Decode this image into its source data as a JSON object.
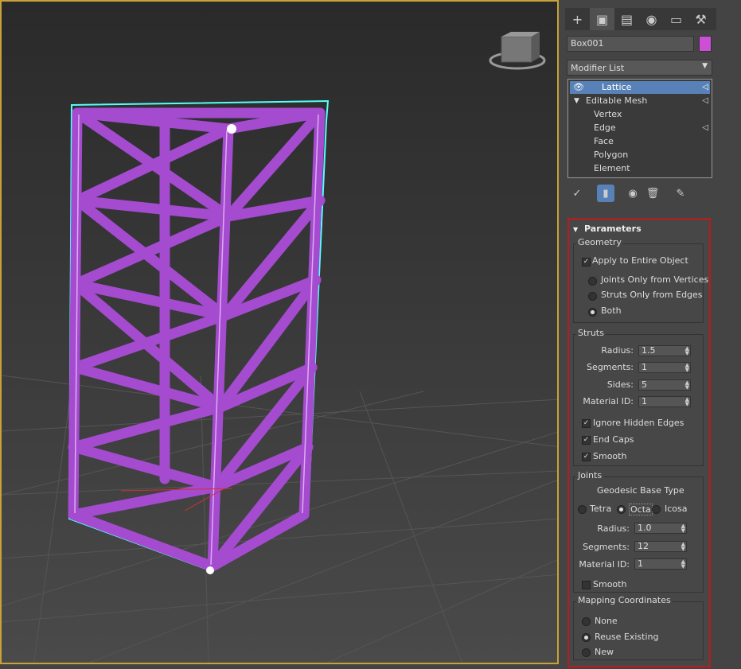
{
  "command_tabs": [
    "create-icon",
    "modify-icon",
    "hierarchy-icon",
    "motion-icon",
    "display-icon",
    "utilities-icon"
  ],
  "object": {
    "name": "Box001",
    "color": "#cc4fd6"
  },
  "modifier_list": {
    "label": "Modifier List"
  },
  "stack": {
    "items": [
      {
        "label": "Lattice",
        "selected": true
      },
      {
        "label": "Editable Mesh"
      },
      {
        "label": "Vertex"
      },
      {
        "label": "Edge"
      },
      {
        "label": "Face"
      },
      {
        "label": "Polygon"
      },
      {
        "label": "Element"
      }
    ]
  },
  "parameters": {
    "title": "Parameters",
    "geometry": {
      "title": "Geometry",
      "apply_entire": "Apply to Entire Object",
      "joints_only": "Joints Only from Vertices",
      "struts_only": "Struts Only from Edges",
      "both": "Both"
    },
    "struts": {
      "title": "Struts",
      "radius_label": "Radius:",
      "radius": "1.5",
      "segments_label": "Segments:",
      "segments": "1",
      "sides_label": "Sides:",
      "sides": "5",
      "matid_label": "Material ID:",
      "matid": "1",
      "ignore_hidden": "Ignore Hidden Edges",
      "end_caps": "End Caps",
      "smooth": "Smooth"
    },
    "joints": {
      "title": "Joints",
      "geodesic_label": "Geodesic Base Type",
      "tetra": "Tetra",
      "octa": "Octa",
      "icosa": "Icosa",
      "radius_label": "Radius:",
      "radius": "1.0",
      "segments_label": "Segments:",
      "segments": "12",
      "matid_label": "Material ID:",
      "matid": "1",
      "smooth": "Smooth"
    },
    "mapping": {
      "title": "Mapping Coordinates",
      "none": "None",
      "reuse": "Reuse Existing",
      "new": "New"
    }
  }
}
